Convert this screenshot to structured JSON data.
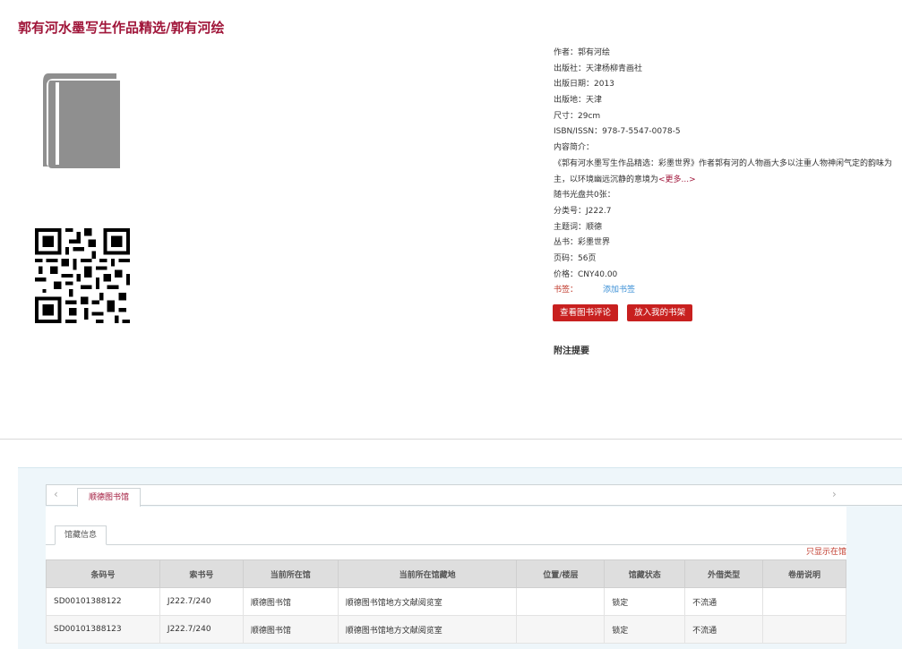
{
  "book": {
    "title": "郭有河水墨写生作品精选/郭有河绘",
    "icon": "book-icon",
    "qr_icon": "qr-code-icon"
  },
  "info": {
    "author": "作者：郭有河绘",
    "publisher": "出版社：天津杨柳青画社",
    "pub_date": "出版日期：2013",
    "pub_place": "出版地：天津",
    "size": "尺寸：29cm",
    "isbn": "ISBN/ISSN：978-7-5547-0078-5",
    "summary_label": "内容简介：",
    "summary_text": "《郭有河水墨写生作品精选：彩墨世界》作者郭有河的人物画大多以注重人物神闲气定的韵味为主，以环境幽远沉静的意境为",
    "more": "<更多...>",
    "cd": "随书光盘共0张：",
    "class_no": "分类号：J222.7",
    "subject": "主题词：顺德",
    "series": "丛书：彩墨世界",
    "pages": "页码：56页",
    "price": "价格：CNY40.00",
    "bookmark_label": "书签：",
    "bookmark_link": "添加书签"
  },
  "buttons": {
    "review": "查看图书评论",
    "shelf": "放入我的书架"
  },
  "notes_label": "附注提要",
  "library_tab": "顺德图书馆",
  "holdings_tab": "馆藏信息",
  "only_this_library": "只显示在馆",
  "table": {
    "headers": [
      "条码号",
      "索书号",
      "当前所在馆",
      "当前所在馆藏地",
      "位置/楼层",
      "馆藏状态",
      "外借类型",
      "卷册说明"
    ],
    "rows": [
      [
        "SD00101388122",
        "J222.7/240",
        "顺德图书馆",
        "顺德图书馆地方文献阅览室",
        "",
        "锁定",
        "不流通",
        ""
      ],
      [
        "SD00101388123",
        "J222.7/240",
        "顺德图书馆",
        "顺德图书馆地方文献阅览室",
        "",
        "锁定",
        "不流通",
        ""
      ]
    ]
  },
  "colors": {
    "accent": "#a0163a",
    "button": "#c8201f",
    "link": "#3a8fd6"
  }
}
